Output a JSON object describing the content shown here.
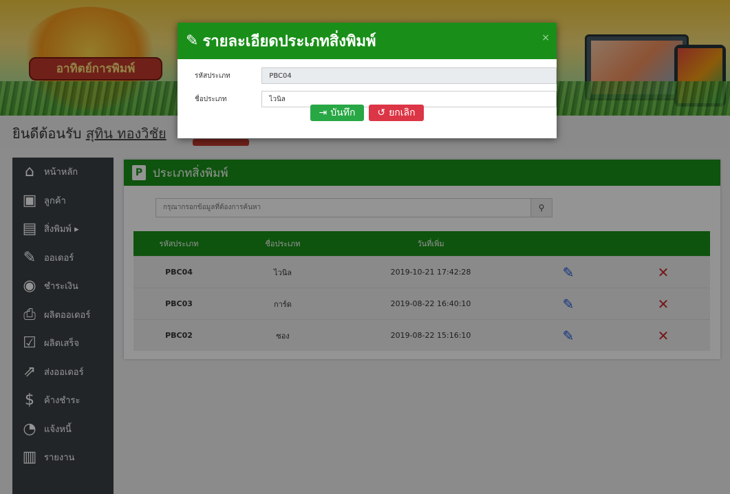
{
  "header": {
    "logo_text": "อาทิตย์การพิมพ์"
  },
  "greeting": {
    "prefix": "ยินดีต้อนรับ",
    "user": "สุทิน ทองวิชัย"
  },
  "sidebar": {
    "items": [
      {
        "label": "หน้าหลัก",
        "icon": "home-icon"
      },
      {
        "label": "ลูกค้า",
        "icon": "customer-icon"
      },
      {
        "label": "สิ่งพิมพ์ ▸",
        "icon": "document-icon"
      },
      {
        "label": "ออเดอร์",
        "icon": "order-icon"
      },
      {
        "label": "ชำระเงิน",
        "icon": "coins-icon"
      },
      {
        "label": "ผลิตออเดอร์",
        "icon": "printer-icon"
      },
      {
        "label": "ผลิตเสร็จ",
        "icon": "checkbox-icon"
      },
      {
        "label": "ส่งออเดอร์",
        "icon": "share-icon"
      },
      {
        "label": "ค้างชำระ",
        "icon": "payment-icon"
      },
      {
        "label": "แจ้งหนี้",
        "icon": "user-clock-icon"
      },
      {
        "label": "รายงาน",
        "icon": "chart-icon"
      }
    ]
  },
  "panel": {
    "title": "ประเภทสิ่งพิมพ์",
    "search_placeholder": "กรุณากรอกข้อมูลที่ต้องการค้นหา",
    "columns": [
      "รหัสประเภท",
      "ชื่อประเภท",
      "วันที่เพิ่ม",
      "",
      ""
    ],
    "rows": [
      {
        "code": "PBC04",
        "name": "ไวนิล",
        "date": "2019-10-21 17:42:28"
      },
      {
        "code": "PBC03",
        "name": "การ์ด",
        "date": "2019-08-22 16:40:10"
      },
      {
        "code": "PBC02",
        "name": "ซอง",
        "date": "2019-08-22 15:16:10"
      }
    ]
  },
  "modal": {
    "title": "รายละเอียดประเภทสิ่งพิมพ์",
    "close": "×",
    "fields": [
      {
        "label": "รหัสประเภท",
        "value": "PBC04"
      },
      {
        "label": "ชื่อประเภท",
        "value": "ไวนิล"
      }
    ],
    "save_label": "บันทึก",
    "cancel_label": "ยกเลิก"
  },
  "colors": {
    "primary_green": "#198f19",
    "sidebar": "#3b4045",
    "danger": "#dc3545",
    "success": "#28a745",
    "edit_blue": "#1a56db"
  }
}
